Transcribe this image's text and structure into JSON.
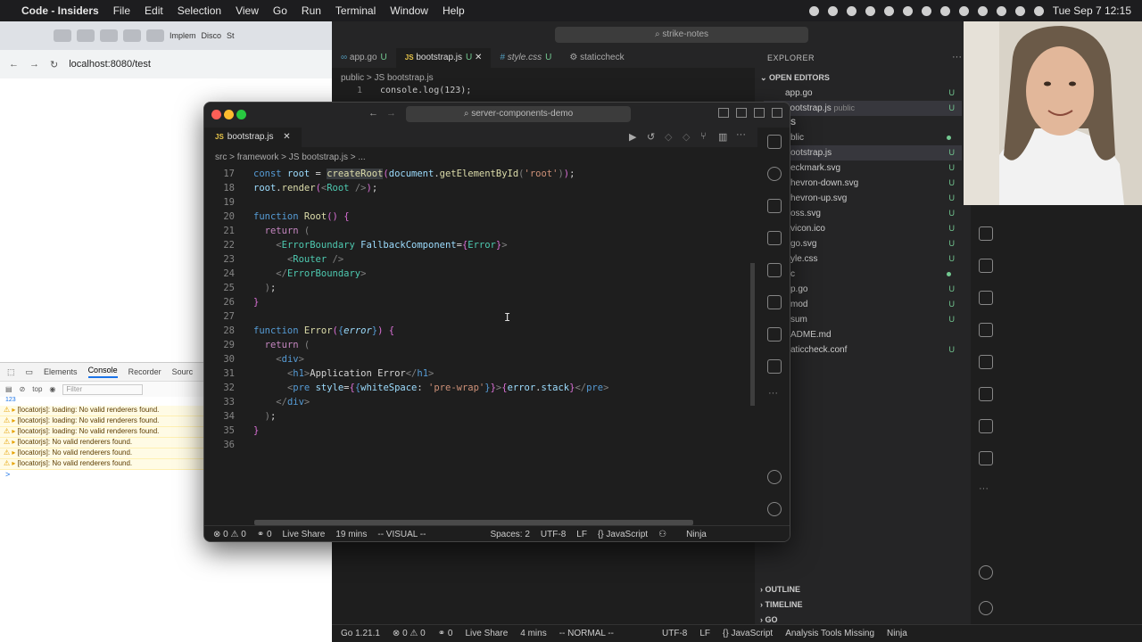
{
  "menubar": {
    "app": "Code - Insiders",
    "items": [
      "File",
      "Edit",
      "Selection",
      "View",
      "Go",
      "Run",
      "Terminal",
      "Window",
      "Help"
    ],
    "clock": "Tue Sep 7  12:15"
  },
  "browser": {
    "url": "localhost:8080/test",
    "tabs": [
      "Implem",
      "Disco",
      "St"
    ],
    "devtools": {
      "tabs": [
        "Elements",
        "Console",
        "Recorder",
        "Sourc"
      ],
      "context": "top",
      "filter_placeholder": "Filter",
      "count": "123",
      "logs": [
        "[locatorjs]: loading: No valid renderers found.",
        "[locatorjs]: loading: No valid renderers found.",
        "[locatorjs]: loading: No valid renderers found.",
        "[locatorjs]: No valid renderers found.",
        "[locatorjs]: No valid renderers found.",
        "[locatorjs]: No valid renderers found."
      ],
      "prompt": ">"
    }
  },
  "back_editor": {
    "title": "strike-notes",
    "tabs": [
      {
        "label": "app.go",
        "status": "U",
        "icon": "go"
      },
      {
        "label": "bootstrap.js",
        "status": "U",
        "icon": "JS"
      },
      {
        "label": "style.css",
        "status": "U",
        "icon": "#"
      },
      {
        "label": "staticcheck",
        "status": "",
        "icon": "gear"
      }
    ],
    "breadcrumb": "public  >  JS bootstrap.js",
    "line_number": "1",
    "line_code": "console.log(123);",
    "explorer": {
      "title": "EXPLORER",
      "open_editors_label": "OPEN EDITORS",
      "open_editors": [
        {
          "label": "app.go",
          "status": "U"
        },
        {
          "label": "bootstrap.js",
          "extra": "public",
          "status": "U"
        }
      ],
      "project_label": "E-NOTES",
      "files": [
        {
          "label": "blic",
          "status": "dot"
        },
        {
          "label": "ootstrap.js",
          "status": "U"
        },
        {
          "label": "eckmark.svg",
          "status": "U"
        },
        {
          "label": "hevron-down.svg",
          "status": "U"
        },
        {
          "label": "hevron-up.svg",
          "status": "U"
        },
        {
          "label": "oss.svg",
          "status": "U"
        },
        {
          "label": "vicon.ico",
          "status": "U"
        },
        {
          "label": "go.svg",
          "status": "U"
        },
        {
          "label": "yle.css",
          "status": "U"
        },
        {
          "label": "c",
          "status": "dot"
        },
        {
          "label": "p.go",
          "status": "U"
        },
        {
          "label": "mod",
          "status": "U"
        },
        {
          "label": "sum",
          "status": "U"
        },
        {
          "label": "ADME.md",
          "status": ""
        },
        {
          "label": "aticcheck.conf",
          "status": "U"
        }
      ],
      "outline_label": "OUTLINE",
      "timeline_label": "TIMELINE",
      "go_label": "GO"
    },
    "status": [
      "Go 1.21.1",
      "⊗ 0 ⚠ 0",
      "⚭ 0",
      "Live Share",
      "4 mins",
      "-- NORMAL --",
      "UTF-8",
      "LF",
      "{} JavaScript",
      "Analysis Tools Missing",
      "Ninja"
    ]
  },
  "front_editor": {
    "title": "server-components-demo",
    "tab": "bootstrap.js",
    "breadcrumb": "src  >  framework  >  JS bootstrap.js  >  ...",
    "status": [
      "⊗ 0 ⚠ 0",
      "⚭ 0",
      "Live Share",
      "19 mins",
      "-- VISUAL --",
      "Spaces: 2",
      "UTF-8",
      "LF",
      "{} JavaScript",
      "Ninja"
    ]
  }
}
